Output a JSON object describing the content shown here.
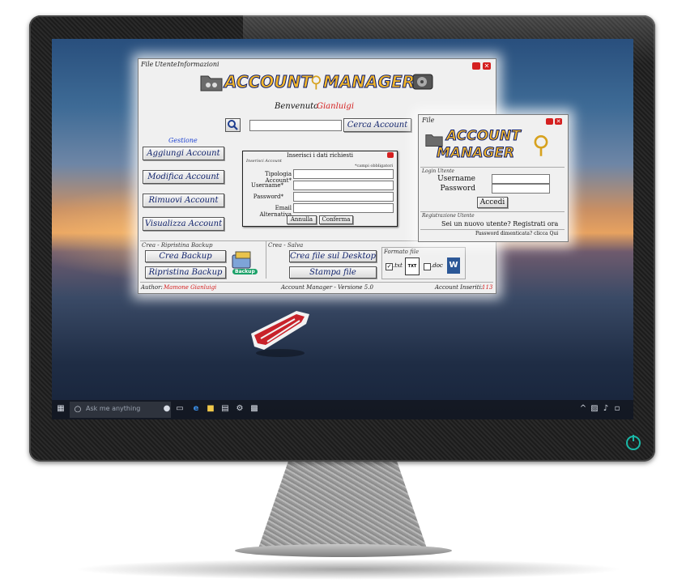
{
  "taskbar": {
    "search_placeholder": "Ask me anything"
  },
  "main_window": {
    "menu": [
      "File",
      "Utente",
      "Informazioni"
    ],
    "logo": {
      "word1": "ACCOUNT",
      "word2": "MANAGER"
    },
    "welcome_label": "Benvenuto",
    "welcome_user": "Gianluigi",
    "search_button": "Cerca Account",
    "gestione_title": "Gestione",
    "buttons": {
      "add": "Aggiungi Account",
      "edit": "Modifica Account",
      "remove": "Rimuovi Account",
      "view": "Visualizza Account"
    },
    "backup_section": {
      "title": "Crea - Ripristina Backup",
      "create": "Crea Backup",
      "restore": "Ripristina Backup",
      "badge": "Backup"
    },
    "save_section": {
      "title": "Crea - Salva",
      "desktop": "Crea file sul Desktop",
      "print": "Stampa file"
    },
    "format_section": {
      "title": "Formato file",
      "txt_label": ".txt",
      "txt_icon_text": "TXT",
      "doc_label": ".doc",
      "txt_checked": true,
      "doc_checked": false
    },
    "status": {
      "author_label": "Author:",
      "author_name": "Mamone Gianluigi",
      "version": "Account Manager - Versione 5.0",
      "count_label": "Account Inseriti:",
      "count_value": "113"
    }
  },
  "dialog": {
    "title": "Inserisci i dati richiesti",
    "section": "Inserisci Account",
    "required_note": "*campi obbligatori",
    "fields": [
      "Tipologia Account*",
      "Username*",
      "Password*",
      "Email Alternativa"
    ],
    "cancel": "Annulla",
    "confirm": "Conferma"
  },
  "login_window": {
    "menu": "File",
    "logo": {
      "word1": "ACCOUNT",
      "word2": "MANAGER"
    },
    "login_section": "Login Utente",
    "username_label": "Username",
    "password_label": "Password",
    "login_button": "Accedi",
    "register_section": "Registrazione Utente",
    "register_text": "Sei un nuovo utente? Registrati ora",
    "forgot_text": "Password dimenticata? clicca Qui"
  },
  "colors": {
    "accent_red": "#d42020",
    "button_text": "#10226b",
    "gestione_blue": "#1a3fd0",
    "power_teal": "#19b9a8"
  }
}
